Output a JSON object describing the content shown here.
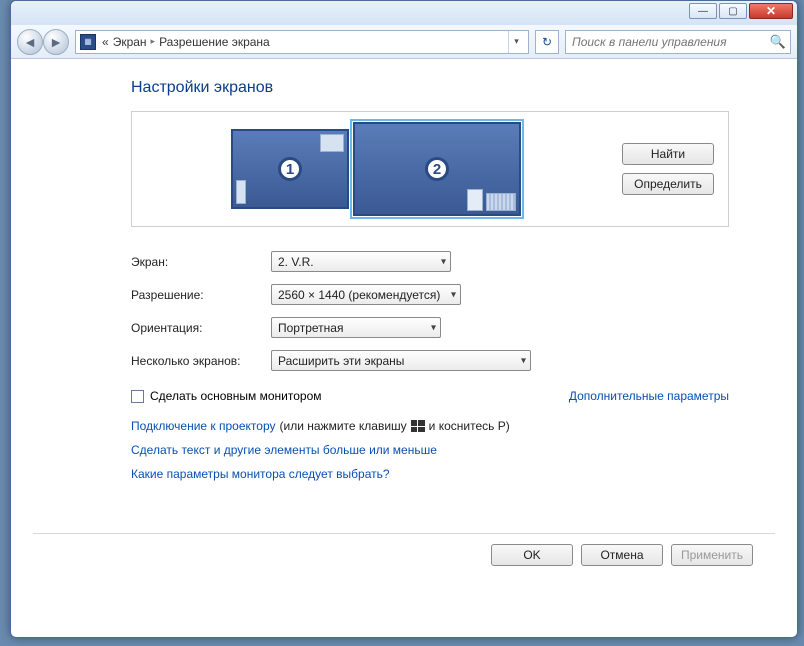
{
  "breadcrumb": {
    "prefix": "«",
    "part1": "Экран",
    "part2": "Разрешение экрана"
  },
  "search": {
    "placeholder": "Поиск в панели управления"
  },
  "heading": "Настройки экранов",
  "monitors": {
    "n1": "1",
    "n2": "2"
  },
  "side": {
    "find": "Найти",
    "identify": "Определить"
  },
  "form": {
    "screen_label": "Экран:",
    "screen_value": "2. V.R.",
    "resolution_label": "Разрешение:",
    "resolution_value": "2560 × 1440 (рекомендуется)",
    "orientation_label": "Ориентация:",
    "orientation_value": "Портретная",
    "multi_label": "Несколько экранов:",
    "multi_value": "Расширить эти экраны"
  },
  "checkbox": {
    "label": "Сделать основным монитором"
  },
  "adv_link": "Дополнительные параметры",
  "projector": {
    "link": "Подключение к проектору",
    "hint_before": "(или нажмите клавишу",
    "hint_after": "и коснитесь P)"
  },
  "text_size_link": "Сделать текст и другие элементы больше или меньше",
  "which_settings_link": "Какие параметры монитора следует выбрать?",
  "footer": {
    "ok": "OK",
    "cancel": "Отмена",
    "apply": "Применить"
  }
}
